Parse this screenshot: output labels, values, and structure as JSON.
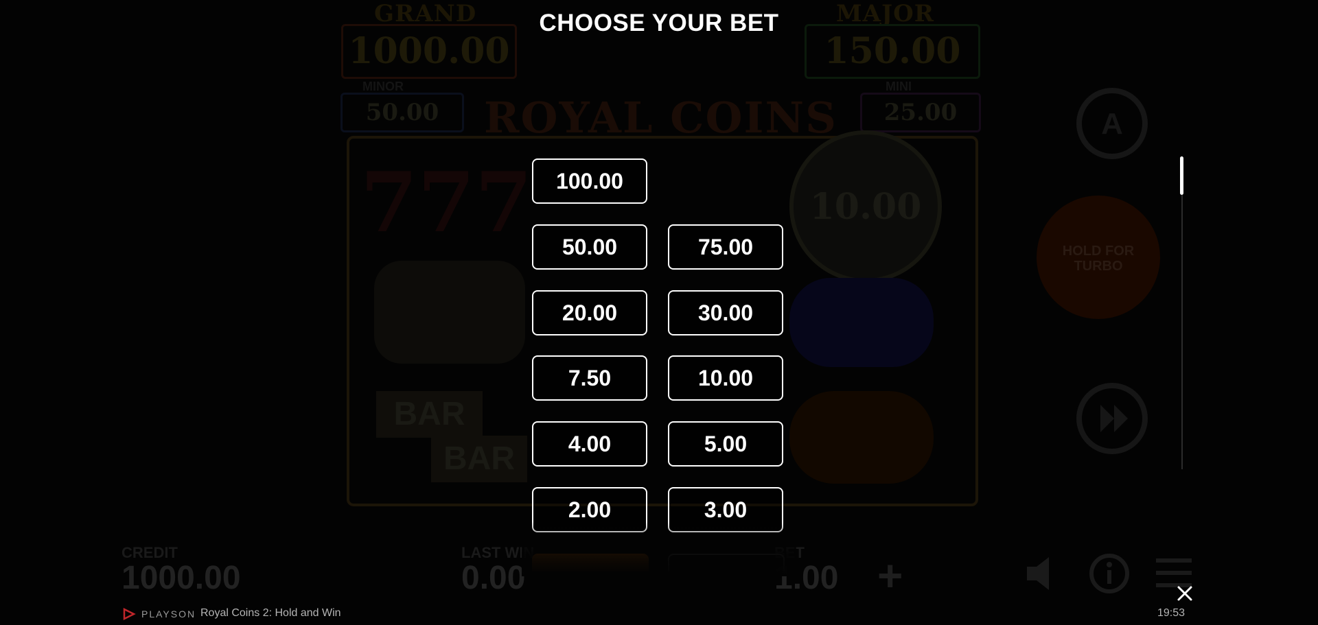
{
  "modal": {
    "title": "CHOOSE YOUR BET",
    "bets": [
      "100.00",
      "50.00",
      "75.00",
      "20.00",
      "30.00",
      "7.50",
      "10.00",
      "4.00",
      "5.00",
      "2.00",
      "3.00"
    ],
    "scroll_position": 0.05
  },
  "background": {
    "jackpots": {
      "grand_label": "GRAND",
      "grand_value": "1000.00",
      "major_label": "MAJOR",
      "major_value": "150.00",
      "minor_label": "MINOR",
      "minor_value": "50.00",
      "mini_label": "MINI",
      "mini_value": "25.00"
    },
    "logo": "ROYAL COINS",
    "coin_value": "10.00",
    "credit_label": "CREDIT",
    "credit_value": "1000.00",
    "lastwin_label": "LAST WIN",
    "lastwin_value": "0.00",
    "bet_label": "BET",
    "bet_value": "1.00",
    "turbo_label": "HOLD FOR TURBO"
  },
  "footer": {
    "brand": "PLAYSON",
    "game_name": "Royal Coins 2: Hold and Win",
    "time": "19:53"
  },
  "colors": {
    "accent": "#b65a05",
    "text": "#ffffff",
    "background": "#030303"
  },
  "icons": [
    "autoplay-icon",
    "spin-icon",
    "fast-forward-icon",
    "sound-icon",
    "info-icon",
    "menu-icon",
    "plus-icon",
    "close-icon",
    "playson-logo-icon"
  ]
}
